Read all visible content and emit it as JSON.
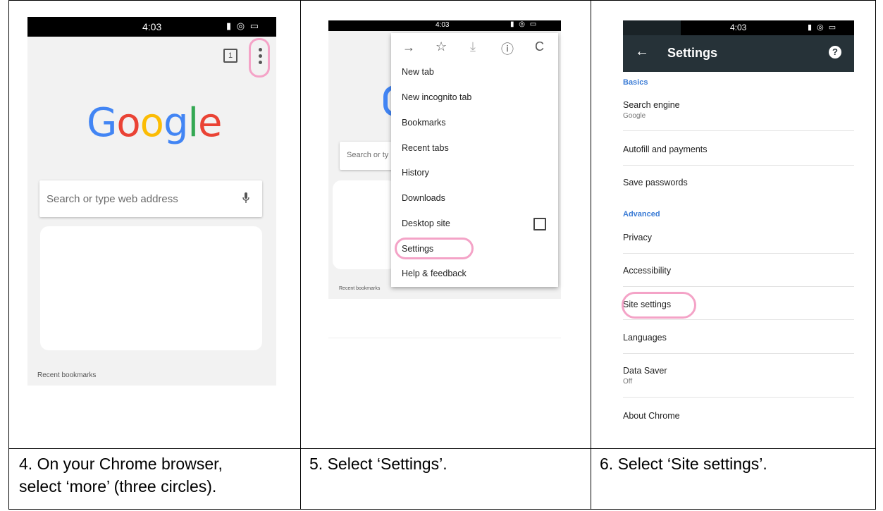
{
  "step4": {
    "status_time": "4:03",
    "status_icons": "▮ ◎ ▭",
    "tab_count": "1",
    "logo": {
      "G": "G",
      "o1": "o",
      "o2": "o",
      "g": "g",
      "l": "l",
      "e": "e"
    },
    "search_placeholder": "Search or type web address",
    "recent_bookmarks": "Recent bookmarks",
    "caption_line1": "4. On your Chrome browser,",
    "caption_line2": "select ‘more’ (three circles)."
  },
  "step5": {
    "status_time": "4:03",
    "status_icons": "▮ ◎ ▭",
    "search_partial": "Search or ty",
    "recent_bookmarks": "Recent bookmarks",
    "menu_top": {
      "forward": "→",
      "star": "☆",
      "download": "⤓",
      "info": "ⓘ",
      "reload": "C"
    },
    "menu_items": [
      "New tab",
      "New incognito tab",
      "Bookmarks",
      "Recent tabs",
      "History",
      "Downloads",
      "Desktop site",
      "Settings",
      "Help & feedback"
    ],
    "caption": "5. Select ‘Settings’."
  },
  "step6": {
    "status_time": "4:03",
    "status_icons": "▮ ◎ ▭",
    "back": "←",
    "title": "Settings",
    "help": "?",
    "section_basics": "Basics",
    "search_engine": "Search engine",
    "search_engine_value": "Google",
    "autofill": "Autofill and payments",
    "save_passwords": "Save passwords",
    "section_advanced": "Advanced",
    "privacy": "Privacy",
    "accessibility": "Accessibility",
    "site_settings": "Site settings",
    "languages": "Languages",
    "data_saver": "Data Saver",
    "data_saver_value": "Off",
    "about_chrome": "About Chrome",
    "caption": "6. Select ‘Site settings’."
  },
  "colors": {
    "google_blue": "#4285F4",
    "google_red": "#EA4335",
    "google_yellow": "#FBBC05",
    "google_green": "#34A853",
    "highlight_pink": "#f4a3c7",
    "toolbar": "#263238",
    "section_blue": "#3a7bd5"
  }
}
